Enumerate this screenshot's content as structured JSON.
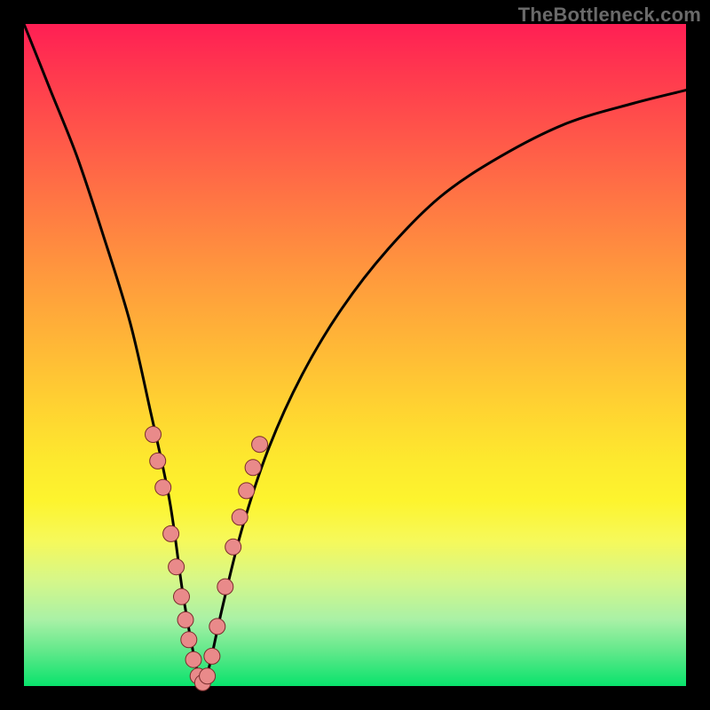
{
  "watermark": "TheBottleneck.com",
  "colors": {
    "frame": "#000000",
    "curve": "#000000",
    "marker_fill": "#e98a8a",
    "marker_stroke": "#7a2c2c"
  },
  "chart_data": {
    "type": "line",
    "title": "",
    "xlabel": "",
    "ylabel": "",
    "xlim": [
      0,
      100
    ],
    "ylim": [
      0,
      100
    ],
    "grid": false,
    "legend": false,
    "note": "No numeric axis ticks or labels are shown in the image; x/y are in percent of plot area. Curve dips to ~0 near x≈27 and rises on both sides.",
    "series": [
      {
        "name": "curve",
        "x": [
          0,
          4,
          8,
          12,
          16,
          19,
          22,
          24,
          26,
          27,
          28,
          30,
          33,
          37,
          42,
          48,
          55,
          63,
          72,
          82,
          92,
          100
        ],
        "y": [
          100,
          90,
          80,
          68,
          55,
          42,
          28,
          14,
          3,
          0,
          3,
          12,
          24,
          36,
          47,
          57,
          66,
          74,
          80,
          85,
          88,
          90
        ]
      }
    ],
    "markers": {
      "name": "highlighted-points",
      "x": [
        19.5,
        20.2,
        21.0,
        22.2,
        23.0,
        23.8,
        24.4,
        24.9,
        25.6,
        26.3,
        27.0,
        27.7,
        28.4,
        29.2,
        30.4,
        31.6,
        32.6,
        33.6,
        34.6,
        35.6
      ],
      "y": [
        38.0,
        34.0,
        30.0,
        23.0,
        18.0,
        13.5,
        10.0,
        7.0,
        4.0,
        1.5,
        0.5,
        1.5,
        4.5,
        9.0,
        15.0,
        21.0,
        25.5,
        29.5,
        33.0,
        36.5
      ]
    }
  }
}
